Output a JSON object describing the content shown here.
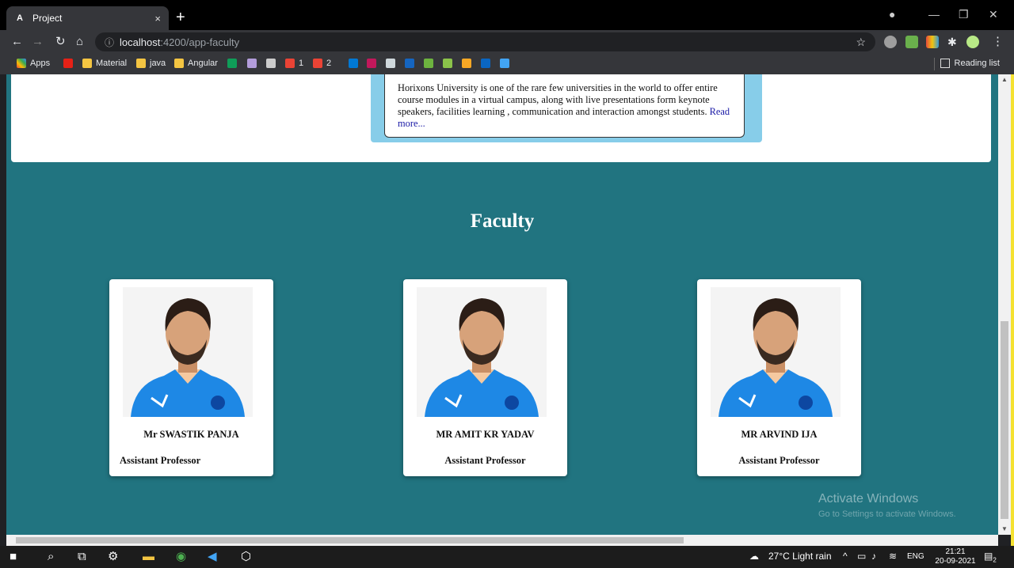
{
  "browser": {
    "tab_title": "Project",
    "tab_favicon": "A",
    "tab_close": "×",
    "new_tab": "+",
    "url_host": "localhost",
    "url_path": ":4200/app-faculty",
    "reading_list": "Reading list"
  },
  "bookmarks": [
    {
      "label": "Apps"
    },
    {
      "label": "Material"
    },
    {
      "label": "java"
    },
    {
      "label": "Angular"
    },
    {
      "label": "1"
    },
    {
      "label": "2"
    }
  ],
  "about": {
    "text": "Horixons University is one of the rare few universities in the world to offer entire course modules in a virtual campus, along with live presentations form keynote speakers, facilities learning , communication and interaction amongst students.",
    "link": "Read more..."
  },
  "faculty": {
    "title": "Faculty",
    "members": [
      {
        "name": "Mr SWASTIK PANJA",
        "role": "Assistant Professor"
      },
      {
        "name": "MR AMIT KR YADAV",
        "role": "Assistant Professor"
      },
      {
        "name": "MR ARVIND IJA",
        "role": "Assistant Professor"
      }
    ]
  },
  "watermark": {
    "title": "Activate Windows",
    "subtitle": "Go to Settings to activate Windows."
  },
  "taskbar": {
    "weather": "27°C  Light rain",
    "lang": "ENG",
    "time": "21:21",
    "date": "20-09-2021",
    "notif_count": "2"
  },
  "colors": {
    "page_bg": "#217480",
    "about_panel": "#87cde9",
    "link": "#1a1aa6"
  }
}
